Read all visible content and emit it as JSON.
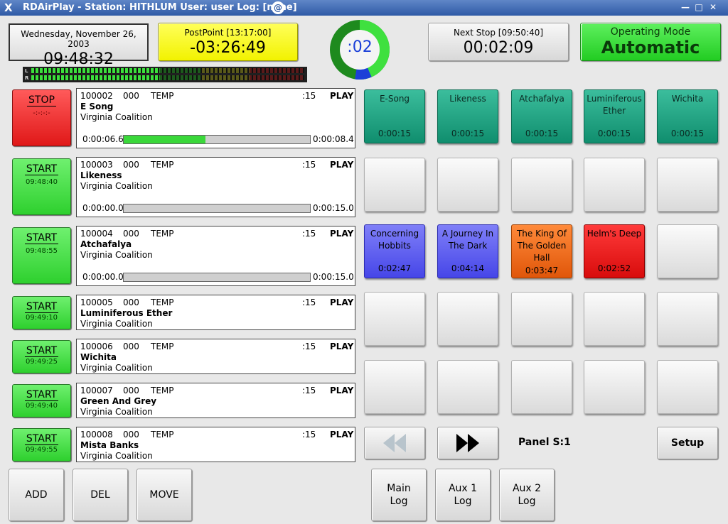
{
  "window": {
    "title": "RDAirPlay - Station: HITHLUM  User: user  Log: [none]",
    "controls": [
      "—",
      "□",
      "✕"
    ]
  },
  "clock": {
    "date": "Wednesday, November 26, 2003",
    "time": "09:48:32"
  },
  "postpoint": {
    "label": "PostPoint [13:17:00]",
    "value": "-03:26:49"
  },
  "pie": {
    "value": ":02",
    "progress": 0.13
  },
  "next_stop": {
    "label": "Next Stop [09:50:40]",
    "value": "00:02:09"
  },
  "mode": {
    "label": "Operating Mode",
    "value": "Automatic"
  },
  "meter": {
    "left_label": "L",
    "right_label": "R",
    "left_level": 0.47,
    "right_level": 0.47
  },
  "log": [
    {
      "button": "STOP",
      "button_time": "-:-:-:-",
      "cart": "100002",
      "cut": "000",
      "group": "TEMP",
      "length": ":15",
      "trans": "PLAY",
      "title": "E Song",
      "artist": "Virginia Coalition",
      "pos": "0:00:06.6",
      "remain": "0:00:08.4",
      "progress": 0.44
    },
    {
      "button": "START",
      "button_time": "09:48:40",
      "cart": "100003",
      "cut": "000",
      "group": "TEMP",
      "length": ":15",
      "trans": "PLAY",
      "title": "Likeness",
      "artist": "Virginia Coalition",
      "pos": "0:00:00.0",
      "remain": "0:00:15.0",
      "progress": 0
    },
    {
      "button": "START",
      "button_time": "09:48:55",
      "cart": "100004",
      "cut": "000",
      "group": "TEMP",
      "length": ":15",
      "trans": "PLAY",
      "title": "Atchafalya",
      "artist": "Virginia Coalition",
      "pos": "0:00:00.0",
      "remain": "0:00:15.0",
      "progress": 0
    },
    {
      "button": "START",
      "button_time": "09:49:10",
      "cart": "100005",
      "cut": "000",
      "group": "TEMP",
      "length": ":15",
      "trans": "PLAY",
      "title": "Luminiferous Ether",
      "artist": "Virginia Coalition"
    },
    {
      "button": "START",
      "button_time": "09:49:25",
      "cart": "100006",
      "cut": "000",
      "group": "TEMP",
      "length": ":15",
      "trans": "PLAY",
      "title": "Wichita",
      "artist": "Virginia Coalition"
    },
    {
      "button": "START",
      "button_time": "09:49:40",
      "cart": "100007",
      "cut": "000",
      "group": "TEMP",
      "length": ":15",
      "trans": "PLAY",
      "title": "Green And Grey",
      "artist": "Virginia Coalition"
    },
    {
      "button": "START",
      "button_time": "09:49:55",
      "cart": "100008",
      "cut": "000",
      "group": "TEMP",
      "length": ":15",
      "trans": "PLAY",
      "title": "Mista Banks",
      "artist": "Virginia Coalition"
    }
  ],
  "carts": [
    {
      "title": "E-Song",
      "length": "0:00:15",
      "color": "teal"
    },
    {
      "title": "Likeness",
      "length": "0:00:15",
      "color": "teal"
    },
    {
      "title": "Atchafalya",
      "length": "0:00:15",
      "color": "teal"
    },
    {
      "title": "Luminiferous Ether",
      "length": "0:00:15",
      "color": "teal"
    },
    {
      "title": "Wichita",
      "length": "0:00:15",
      "color": "teal"
    },
    {
      "title": "Concerning Hobbits",
      "length": "0:02:47",
      "color": "blue"
    },
    {
      "title": "A Journey In The Dark",
      "length": "0:04:14",
      "color": "blue"
    },
    {
      "title": "The King Of The Golden Hall",
      "length": "0:03:47",
      "color": "orange"
    },
    {
      "title": "Helm's Deep",
      "length": "0:02:52",
      "color": "red"
    }
  ],
  "panel": {
    "label": "Panel S:1",
    "setup": "Setup"
  },
  "bottom": {
    "add": "ADD",
    "del": "DEL",
    "move": "MOVE",
    "main_log": "Main Log",
    "aux1": "Aux 1 Log",
    "aux2": "Aux 2 Log"
  }
}
